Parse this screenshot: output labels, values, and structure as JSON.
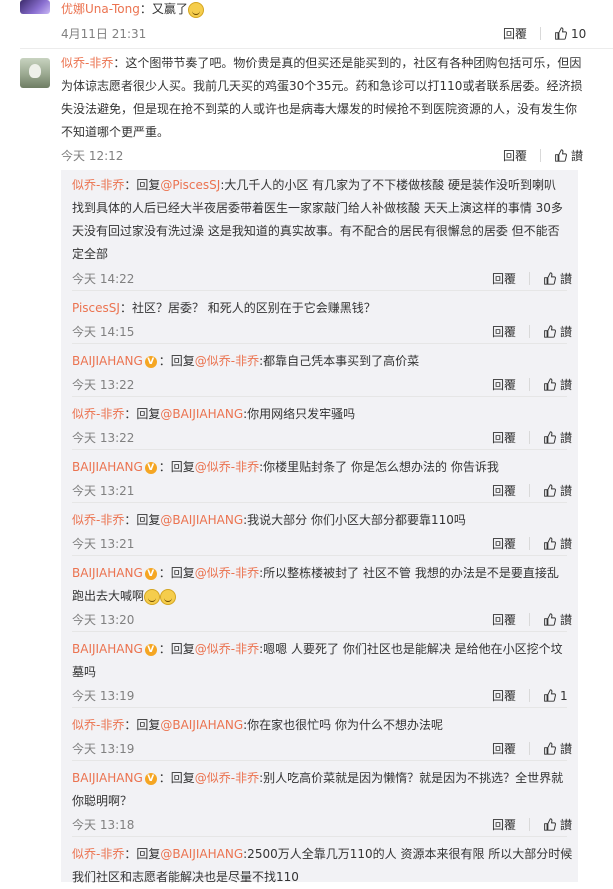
{
  "top_comment": {
    "user": "优娜Una-Tong",
    "text": "又赢了",
    "time": "4月11日 21:31",
    "reply_label": "回覆",
    "like_count": "10"
  },
  "main_comment": {
    "user": "似乔-非乔",
    "lines": [
      "：这个图带节奏了吧。物价贵是真的但买还是能买到的，社区有各种团购包括可乐，但因",
      "为体谅志愿者很少人买。我前几天买的鸡蛋30个35元。药和急诊可以打110或者联系居委。经济损",
      "失没法避免，但是现在抢不到菜的人或许也是病毒大爆发的时候抢不到医院资源的人，没有发生你",
      "不知道哪个更严重。"
    ],
    "time": "今天 12:12",
    "reply_label": "回覆",
    "like_label": "讃"
  },
  "replies": [
    {
      "user": "似乔-非乔",
      "verified": false,
      "prefix": "：回复",
      "mention": "@PiscesSJ",
      "lines": [
        ":大几千人的小区 有几家为了不下楼做核酸 硬是装作没听到喇叭",
        "找到具体的人后已经大半夜居委带着医生一家家敲门给人补做核酸 天天上演这样的事情 30多",
        "天没有回过家没有洗过澡 这是我知道的真实故事。有不配合的居民有很懈怠的居委 但不能否",
        "定全部"
      ],
      "time": "今天 14:22",
      "like": "讃"
    },
    {
      "user": "PiscesSJ",
      "verified": false,
      "prefix": "",
      "mention": "",
      "lines": [
        "：社区？居委？ 和死人的区别在于它会赚黑钱？"
      ],
      "time": "今天 14:15",
      "like": "讃"
    },
    {
      "user": "BAIJIAHANG",
      "verified": true,
      "prefix": "：回复",
      "mention": "@似乔-非乔",
      "lines": [
        ":都靠自己凭本事买到了高价菜"
      ],
      "time": "今天 13:22",
      "like": "讃"
    },
    {
      "user": "似乔-非乔",
      "verified": false,
      "prefix": "：回复",
      "mention": "@BAIJIAHANG",
      "lines": [
        ":你用网络只发牢骚吗"
      ],
      "time": "今天 13:22",
      "like": "讃"
    },
    {
      "user": "BAIJIAHANG",
      "verified": true,
      "prefix": "：回复",
      "mention": "@似乔-非乔",
      "lines": [
        ":你楼里贴封条了 你是怎么想办法的 你告诉我"
      ],
      "time": "今天 13:21",
      "like": "讃"
    },
    {
      "user": "似乔-非乔",
      "verified": false,
      "prefix": "：回复",
      "mention": "@BAIJIAHANG",
      "lines": [
        ":我说大部分 你们小区大部分都要靠110吗"
      ],
      "time": "今天 13:21",
      "like": "讃"
    },
    {
      "user": "BAIJIAHANG",
      "verified": true,
      "prefix": "：回复",
      "mention": "@似乔-非乔",
      "lines": [
        ":所以整栋楼被封了 社区不管 我想的办法是不是要直接乱",
        "跑出去大喊啊"
      ],
      "emojis": 2,
      "time": "今天 13:20",
      "like": "讃"
    },
    {
      "user": "BAIJIAHANG",
      "verified": true,
      "prefix": "：回复",
      "mention": "@似乔-非乔",
      "lines": [
        ":嗯嗯 人要死了 你们社区也是能解决 是给他在小区挖个坟",
        "墓吗"
      ],
      "time": "今天 13:19",
      "like": "1"
    },
    {
      "user": "似乔-非乔",
      "verified": false,
      "prefix": "：回复",
      "mention": "@BAIJIAHANG",
      "lines": [
        ":你在家也很忙吗 你为什么不想办法呢"
      ],
      "time": "今天 13:19",
      "like": "讃"
    },
    {
      "user": "BAIJIAHANG",
      "verified": true,
      "prefix": "：回复",
      "mention": "@似乔-非乔",
      "lines": [
        ":别人吃高价菜就是因为懒惰？就是因为不挑选？全世界就",
        "你聪明啊？"
      ],
      "time": "今天 13:18",
      "like": "讃"
    },
    {
      "user": "似乔-非乔",
      "verified": false,
      "prefix": "：回复",
      "mention": "@BAIJIAHANG",
      "lines": [
        ":2500万人全靠几万110的人 资源本来很有限 所以大部分时候",
        "我们社区和志愿者能解决也是尽量不找110"
      ],
      "time": "",
      "like": ""
    }
  ],
  "reply_label": "回覆",
  "colors": {
    "accent": "#eb7350",
    "panel": "#f2f2f5",
    "verified": "#f5a623"
  }
}
